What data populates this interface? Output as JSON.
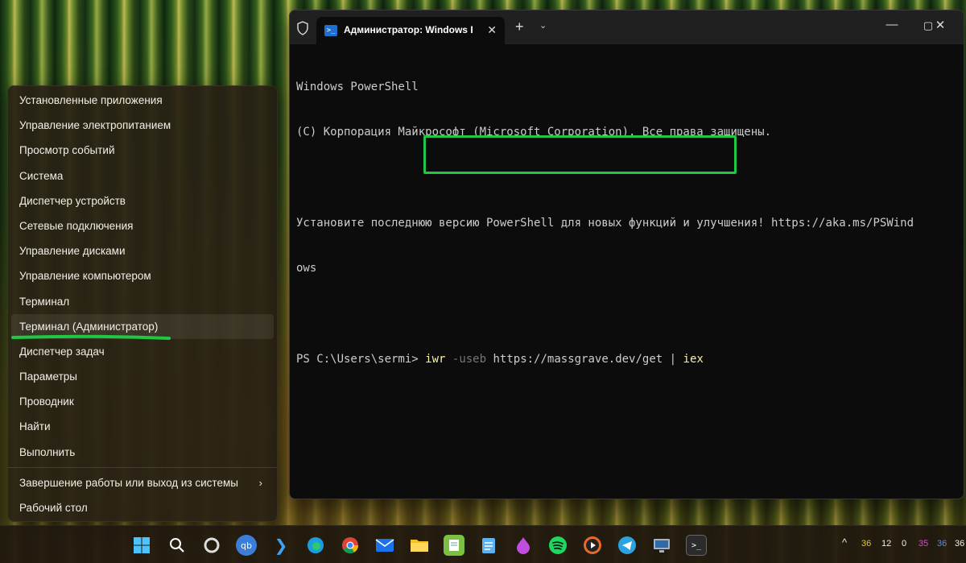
{
  "winx_menu": {
    "items": [
      {
        "label": "Установленные приложения"
      },
      {
        "label": "Управление электропитанием"
      },
      {
        "label": "Просмотр событий"
      },
      {
        "label": "Система"
      },
      {
        "label": "Диспетчер устройств"
      },
      {
        "label": "Сетевые подключения"
      },
      {
        "label": "Управление дисками"
      },
      {
        "label": "Управление компьютером"
      },
      {
        "label": "Терминал"
      },
      {
        "label": "Терминал (Администратор)"
      },
      {
        "label": "Диспетчер задач"
      },
      {
        "label": "Параметры"
      },
      {
        "label": "Проводник"
      },
      {
        "label": "Найти"
      },
      {
        "label": "Выполнить"
      },
      {
        "label": "Завершение работы или выход из системы"
      },
      {
        "label": "Рабочий стол"
      }
    ],
    "highlight_color": "#1fc742"
  },
  "terminal": {
    "tab_title": "Администратор: Windows PowerShell",
    "tab_icon": "powershell-icon",
    "lines": {
      "l1": "Windows PowerShell",
      "l2": "(C) Корпорация Майкрософт (Microsoft Corporation). Все права защищены.",
      "l3": "Установите последнюю версию PowerShell для новых функций и улучшения! https://aka.ms/PSWind",
      "l4": "ows"
    },
    "prompt": "PS C:\\Users\\sermi>",
    "command": {
      "keyword": "iwr",
      "param": "-useb",
      "url": "https://massgrave.dev/get",
      "pipe": "|",
      "pipe_target": "iex"
    }
  },
  "taskbar": {
    "icons": [
      "windows-start-icon",
      "search-icon",
      "copilot-icon",
      "qbittorrent-icon",
      "vscode-icon",
      "edge-icon",
      "chrome-icon",
      "mail-icon",
      "file-explorer-icon",
      "notepad-plus-icon",
      "notepad-icon",
      "teams-icon",
      "spotify-icon",
      "media-player-icon",
      "telegram-icon",
      "remote-desktop-icon",
      "terminal-icon"
    ],
    "tray": {
      "chevron": "^",
      "n1": "36",
      "n2": "12",
      "n3": "0",
      "n4": "35",
      "n5": "36",
      "n6": "36"
    }
  }
}
